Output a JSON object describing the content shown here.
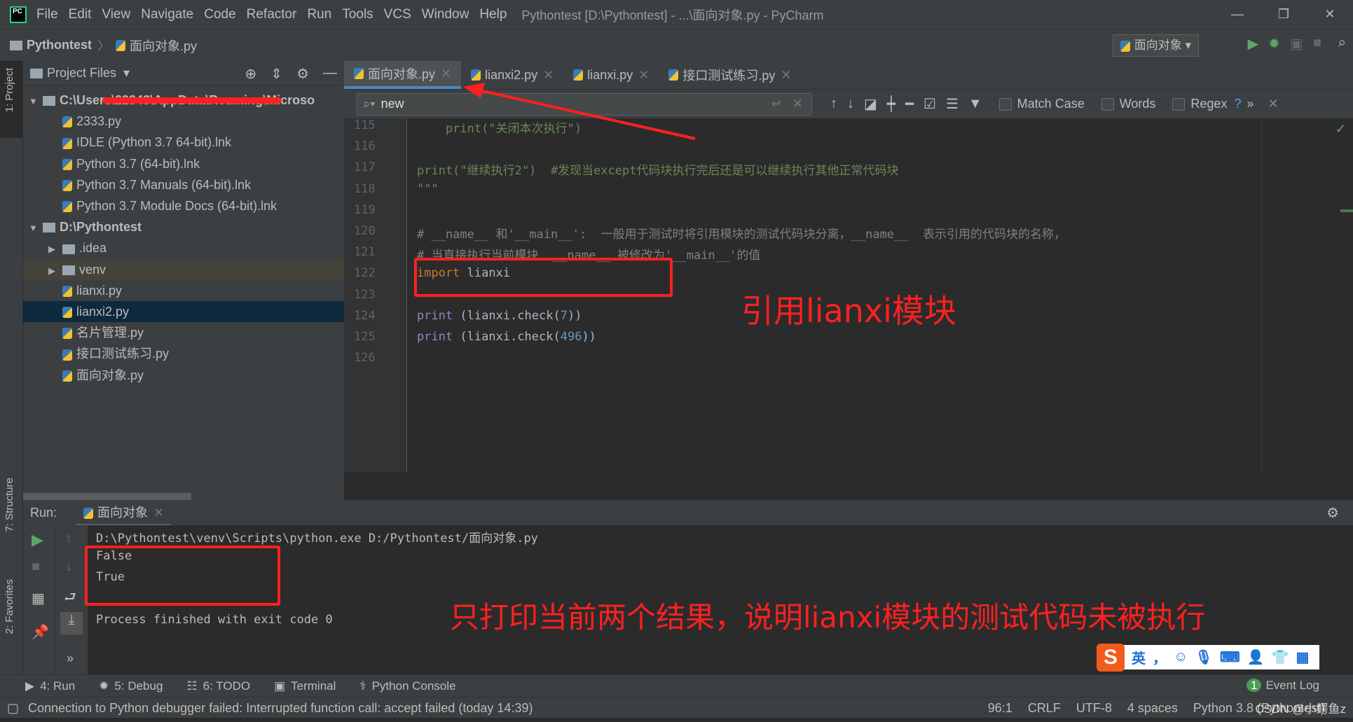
{
  "window": {
    "title": "Pythontest [D:\\Pythontest] - ...\\面向对象.py - PyCharm",
    "menu": [
      "File",
      "Edit",
      "View",
      "Navigate",
      "Code",
      "Refactor",
      "Run",
      "Tools",
      "VCS",
      "Window",
      "Help"
    ]
  },
  "breadcrumb": {
    "project": "Pythontest",
    "file": "面向对象.py"
  },
  "toolbar": {
    "run_config": "面向对象"
  },
  "left_stripe": {
    "project": "1: Project",
    "structure": "7: Structure",
    "favorites": "2: Favorites"
  },
  "project_panel": {
    "title": "Project Files",
    "items": [
      {
        "label": "C:\\Users\\22343\\AppData\\Roaming\\Microso",
        "type": "folder",
        "depth": 0,
        "open": true
      },
      {
        "label": "2333.py",
        "type": "py",
        "depth": 1
      },
      {
        "label": "IDLE (Python 3.7 64-bit).lnk",
        "type": "py",
        "depth": 1
      },
      {
        "label": "Python 3.7 (64-bit).lnk",
        "type": "py",
        "depth": 1
      },
      {
        "label": "Python 3.7 Manuals (64-bit).lnk",
        "type": "py",
        "depth": 1
      },
      {
        "label": "Python 3.7 Module Docs (64-bit).lnk",
        "type": "py",
        "depth": 1
      },
      {
        "label": "D:\\Pythontest",
        "type": "folder",
        "depth": 0,
        "open": true
      },
      {
        "label": ".idea",
        "type": "folder",
        "depth": 1,
        "open": false
      },
      {
        "label": "venv",
        "type": "folder",
        "depth": 1,
        "open": false
      },
      {
        "label": "lianxi.py",
        "type": "py",
        "depth": 1
      },
      {
        "label": "lianxi2.py",
        "type": "py",
        "depth": 1,
        "selected": true
      },
      {
        "label": "名片管理.py",
        "type": "py",
        "depth": 1
      },
      {
        "label": "接口测试练习.py",
        "type": "py",
        "depth": 1
      },
      {
        "label": "面向对象.py",
        "type": "py",
        "depth": 1
      }
    ]
  },
  "editor": {
    "tabs": [
      {
        "label": "面向对象.py",
        "active": true
      },
      {
        "label": "lianxi2.py"
      },
      {
        "label": "lianxi.py"
      },
      {
        "label": "接口测试练习.py"
      }
    ],
    "find": {
      "value": "new",
      "match_case": "Match Case",
      "words": "Words",
      "regex": "Regex",
      "help": "?"
    },
    "lines": [
      {
        "n": "115",
        "parts": [
          [
            "str",
            "    print(\"关闭本次执行\")"
          ]
        ]
      },
      {
        "n": "116",
        "parts": []
      },
      {
        "n": "117",
        "parts": [
          [
            "str",
            "print(\"继续执行2\")  #发现当except代码块执行完后还是可以继续执行其他正常代码块"
          ]
        ]
      },
      {
        "n": "118",
        "parts": [
          [
            "str",
            "\"\"\""
          ]
        ]
      },
      {
        "n": "119",
        "parts": []
      },
      {
        "n": "120",
        "parts": [
          [
            "cmt",
            "# __name__ 和'__main__':  一般用于测试时将引用模块的测试代码块分离，__name__  表示引用的代码块的名称，"
          ]
        ]
      },
      {
        "n": "121",
        "parts": [
          [
            "cmt",
            "# 当直接执行当前模块  __name__ 被修改为'__main__'的值"
          ]
        ]
      },
      {
        "n": "122",
        "parts": [
          [
            "kw",
            "import"
          ],
          [
            "tx",
            " lianxi"
          ]
        ]
      },
      {
        "n": "123",
        "parts": []
      },
      {
        "n": "124",
        "parts": [
          [
            "fn",
            "print"
          ],
          [
            "tx",
            " (lianxi.check("
          ],
          [
            "num",
            "7"
          ],
          [
            "tx",
            "))"
          ]
        ]
      },
      {
        "n": "125",
        "parts": [
          [
            "fn",
            "print"
          ],
          [
            "tx",
            " (lianxi.check("
          ],
          [
            "num",
            "496"
          ],
          [
            "tx",
            "))"
          ]
        ]
      },
      {
        "n": "126",
        "parts": []
      }
    ]
  },
  "run": {
    "label": "Run:",
    "tab": "面向对象",
    "output": [
      "D:\\Pythontest\\venv\\Scripts\\python.exe D:/Pythontest/面向对象.py",
      "False",
      "True",
      "",
      "Process finished with exit code 0"
    ]
  },
  "bottom_tabs": [
    "4: Run",
    "5: Debug",
    "6: TODO",
    "Terminal",
    "Python Console"
  ],
  "event_log": {
    "count": "1",
    "label": "Event Log"
  },
  "status": {
    "message": "Connection to Python debugger failed: Interrupted function call: accept failed (today 14:39)",
    "position": "96:1",
    "line_sep": "CRLF",
    "encoding": "UTF-8",
    "indent": "4 spaces",
    "interpreter": "Python 3.8 (Pythontest)"
  },
  "annotations": {
    "import_note": "引用lianxi模块",
    "output_note": "只打印当前两个结果，说明lianxi模块的测试代码未被执行",
    "accent": "#ff2020"
  },
  "ime": {
    "lang": "英",
    "punct": "，"
  },
  "watermark": "CSDN @小鳄鱼z"
}
